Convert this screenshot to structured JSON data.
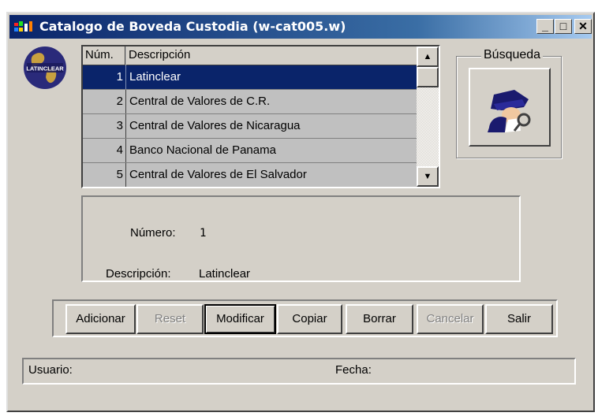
{
  "window": {
    "title": "Catalogo de Boveda Custodia (w-cat005.w)",
    "controls": {
      "minimize": "_",
      "maximize": "□",
      "close": "✕"
    }
  },
  "logo": {
    "text": "LATINCLEAR"
  },
  "list": {
    "headers": {
      "num": "Núm.",
      "desc": "Descripción"
    },
    "rows": [
      {
        "num": "1",
        "desc": "Latinclear"
      },
      {
        "num": "2",
        "desc": "Central de Valores de C.R."
      },
      {
        "num": "3",
        "desc": "Central de Valores de Nicaragua"
      },
      {
        "num": "4",
        "desc": "Banco Nacional de Panama"
      },
      {
        "num": "5",
        "desc": "Central de Valores de El Salvador"
      }
    ],
    "selected_index": 0
  },
  "search": {
    "label": "Búsqueda"
  },
  "detail": {
    "numero_label": "Número:",
    "numero_value": "1",
    "descripcion_label": "Descripción:",
    "descripcion_value": "Latinclear"
  },
  "toolbar": {
    "adicionar": "Adicionar",
    "reset": "Reset",
    "modificar": "Modificar",
    "copiar": "Copiar",
    "borrar": "Borrar",
    "cancelar": "Cancelar",
    "salir": "Salir"
  },
  "status": {
    "usuario_label": "Usuario:",
    "fecha_label": "Fecha:"
  },
  "colors": {
    "selection": "#0a246a",
    "face": "#d4d0c8",
    "list_bg": "#c0c0c0"
  }
}
